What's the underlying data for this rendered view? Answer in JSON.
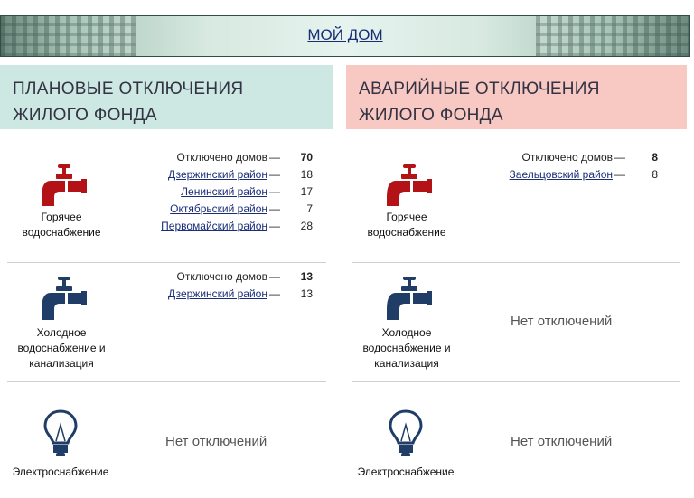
{
  "header": {
    "title": "МОЙ ДОМ"
  },
  "planned": {
    "title": "ПЛАНОВЫЕ ОТКЛЮЧЕНИЯ ЖИЛОГО ФОНДА",
    "hot_water": {
      "label_line1": "Горячее",
      "label_line2": "водоснабжение",
      "total_label": "Отключено домов",
      "total": "70",
      "districts": [
        {
          "name": "Дзержинский район",
          "count": "18"
        },
        {
          "name": "Ленинский район",
          "count": "17"
        },
        {
          "name": "Октябрьский район",
          "count": "7"
        },
        {
          "name": "Первомайский район",
          "count": "28"
        }
      ]
    },
    "cold_water": {
      "label_line1": "Холодное",
      "label_line2": "водоснабжение и",
      "label_line3": "канализация",
      "total_label": "Отключено домов",
      "total": "13",
      "districts": [
        {
          "name": "Дзержинский район",
          "count": "13"
        }
      ]
    },
    "electricity": {
      "label": "Электроснабжение",
      "status": "Нет отключений"
    }
  },
  "emergency": {
    "title": "АВАРИЙНЫЕ ОТКЛЮЧЕНИЯ ЖИЛОГО ФОНДА",
    "hot_water": {
      "label_line1": "Горячее",
      "label_line2": "водоснабжение",
      "total_label": "Отключено домов",
      "total": "8",
      "districts": [
        {
          "name": "Заельцовский район",
          "count": "8"
        }
      ]
    },
    "cold_water": {
      "label_line1": "Холодное",
      "label_line2": "водоснабжение и",
      "label_line3": "канализация",
      "status": "Нет отключений"
    },
    "electricity": {
      "label": "Электроснабжение",
      "status": "Нет отключений"
    }
  },
  "dash": "—",
  "colors": {
    "hot": "#b31217",
    "cold": "#1f3d66",
    "planned_header": "#cde8e2",
    "emergency_header": "#f8c8c2",
    "link": "#1a2e78"
  },
  "icons": {
    "hot_water": "hot-tap-icon",
    "cold_water": "cold-tap-icon",
    "electricity": "light-bulb-icon"
  }
}
